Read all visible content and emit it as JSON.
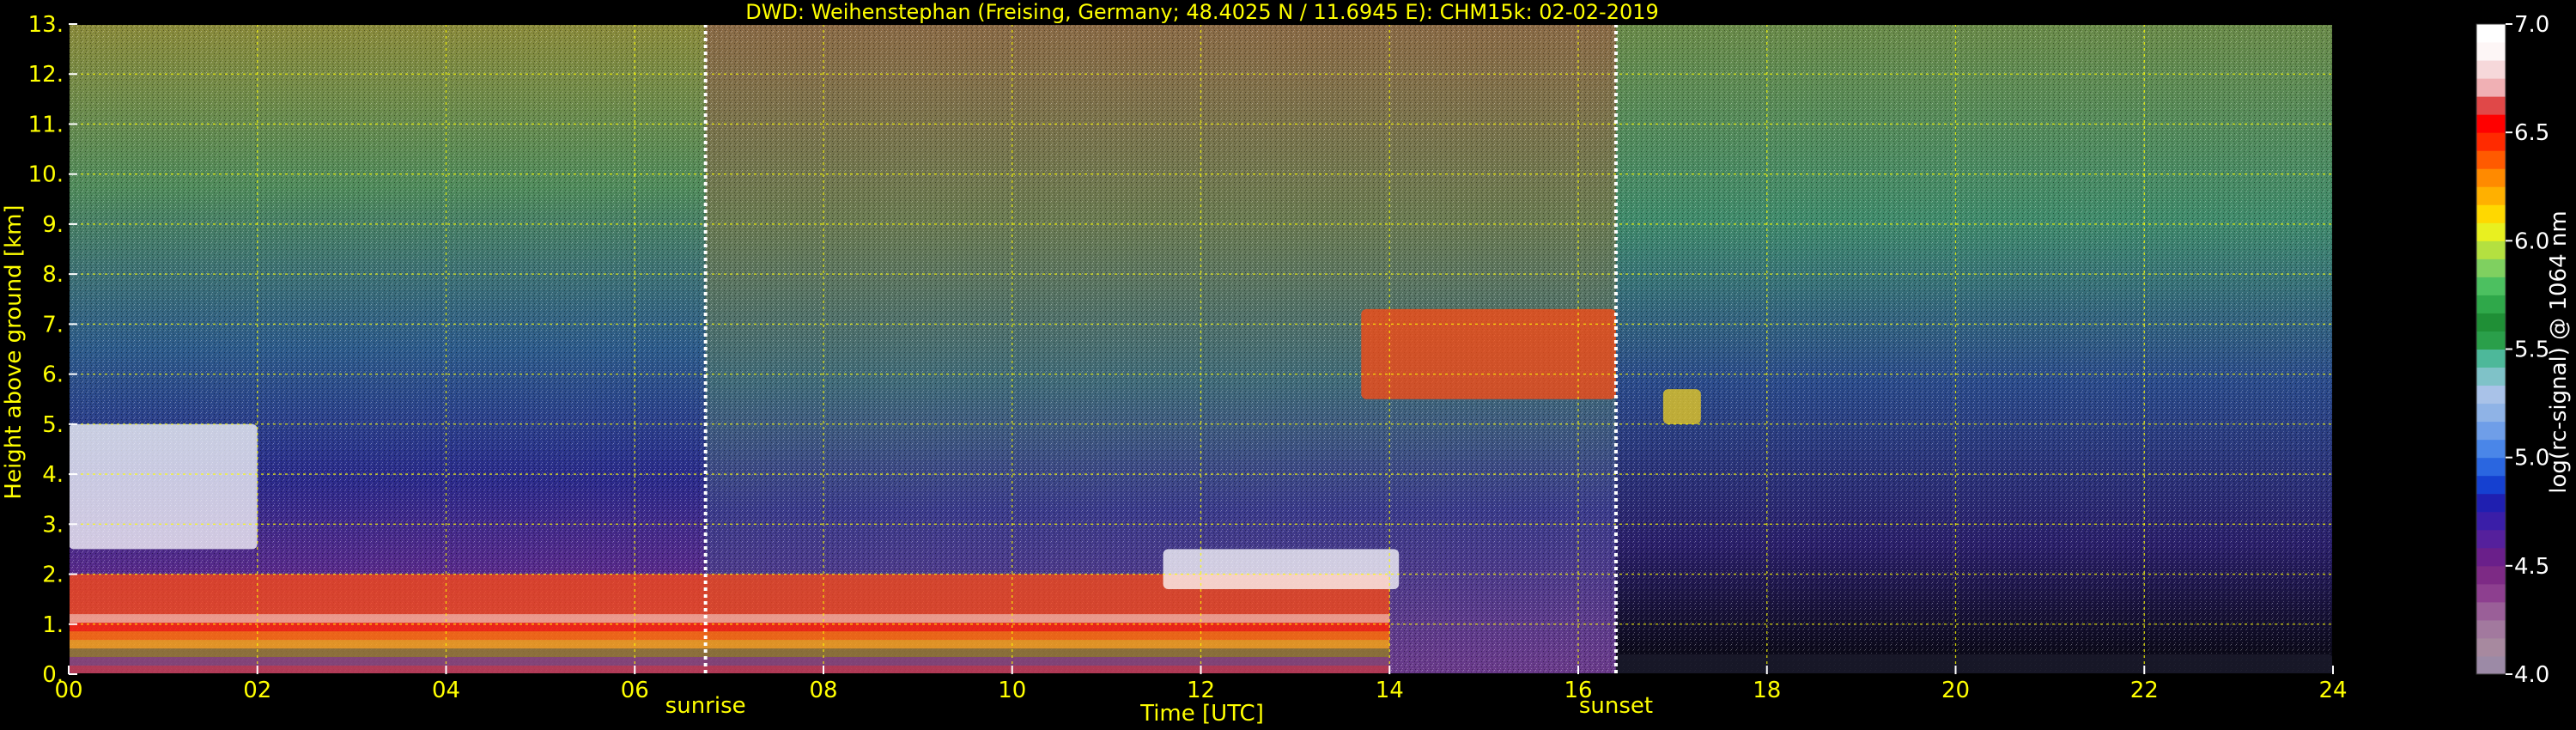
{
  "chart_data": {
    "type": "heatmap",
    "title": "DWD: Weihenstephan (Freising, Germany; 48.4025 N / 11.6945 E):    CHM15k: 02-02-2019",
    "xlabel": "Time [UTC]",
    "ylabel": "Height above ground [km]",
    "xlim": [
      0,
      24
    ],
    "ylim": [
      0,
      13
    ],
    "x_ticks": [
      "00",
      "02",
      "04",
      "06",
      "08",
      "10",
      "12",
      "14",
      "16",
      "18",
      "20",
      "22",
      "24"
    ],
    "y_ticks": [
      "0.",
      "1.",
      "2.",
      "3.",
      "4.",
      "5.",
      "6.",
      "7.",
      "8.",
      "9.",
      "10.",
      "11.",
      "12.",
      "13."
    ],
    "grid": true,
    "colorbar": {
      "label": "log(rc-signal) @ 1064 nm",
      "range": [
        4.0,
        7.0
      ],
      "ticks": [
        "4.0",
        "4.5",
        "5.0",
        "5.5",
        "6.0",
        "6.5",
        "7.0"
      ],
      "tick_values": [
        4.0,
        4.5,
        5.0,
        5.5,
        6.0,
        6.5,
        7.0
      ],
      "colors": [
        "#9c8aa6",
        "#a7899f",
        "#a2799e",
        "#9a5f98",
        "#8d3f8f",
        "#7d2a85",
        "#6a1f8a",
        "#55209c",
        "#3a1ea8",
        "#1f1fb0",
        "#1540d0",
        "#2a66e0",
        "#4a86e8",
        "#6f9ee8",
        "#8fb3e6",
        "#a9c2e8",
        "#7fc2c8",
        "#4db89a",
        "#2a9f4a",
        "#1f8f36",
        "#2fa84a",
        "#4cc060",
        "#7fd060",
        "#b4e040",
        "#e8f020",
        "#ffd800",
        "#ffb000",
        "#ff8a00",
        "#ff5a00",
        "#ff2a00",
        "#ff0000",
        "#e04848",
        "#f0b0b4",
        "#f6d8da",
        "#fdf6f6",
        "#ffffff"
      ]
    },
    "annotations": [
      {
        "text": "sunrise",
        "x": 6.75
      },
      {
        "text": "sunset",
        "x": 16.4
      }
    ],
    "features": [
      {
        "name": "boundary-layer aerosol",
        "time": [
          0,
          14
        ],
        "height_km": [
          0,
          2
        ],
        "signal": "high"
      },
      {
        "name": "low cloud",
        "time": [
          0,
          2
        ],
        "height_km": [
          2.5,
          5
        ],
        "signal": "saturated"
      },
      {
        "name": "high cloud",
        "time": [
          13.7,
          16.4
        ],
        "height_km": [
          5.5,
          7.3
        ],
        "signal": "high"
      },
      {
        "name": "high cloud (night)",
        "time": [
          16.9,
          17.3
        ],
        "height_km": [
          5.0,
          5.7
        ],
        "signal": "medium"
      },
      {
        "name": "cloud layer",
        "time": [
          11.6,
          14.1
        ],
        "height_km": [
          1.7,
          2.5
        ],
        "signal": "saturated"
      },
      {
        "name": "night boundary layer",
        "time": [
          16.4,
          24
        ],
        "height_km": [
          0,
          0.4
        ],
        "signal": "low"
      }
    ]
  }
}
